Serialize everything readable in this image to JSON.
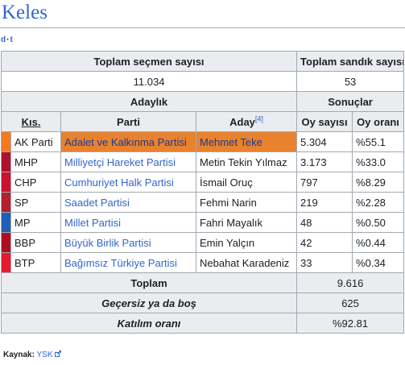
{
  "page": {
    "title": "Keles",
    "navbar": {
      "d": "d",
      "sep": "·",
      "t": "t"
    }
  },
  "summary": {
    "voters_label": "Toplam seçmen sayısı",
    "voters_value": "11.034",
    "boxes_label": "Toplam sandık sayısı",
    "boxes_value": "53"
  },
  "headers": {
    "candidates_group": "Adaylık",
    "results_group": "Sonuçlar",
    "abbr": "Kıs.",
    "party": "Parti",
    "candidate": "Aday",
    "candidate_ref": "[4]",
    "votes": "Oy sayısı",
    "share": "Oy oranı"
  },
  "parties": [
    {
      "abbr": "AK Parti",
      "name": "Adalet ve Kalkınma Partisi",
      "candidate": "Mehmet Teke",
      "candidate_link": true,
      "votes": "5.304",
      "share": "%55.1",
      "color": "#f47920",
      "winner": true
    },
    {
      "abbr": "MHP",
      "name": "Milliyetçi Hareket Partisi",
      "candidate": "Metin Tekin Yılmaz",
      "candidate_link": false,
      "votes": "3.173",
      "share": "%33.0",
      "color": "#b0122a",
      "winner": false
    },
    {
      "abbr": "CHP",
      "name": "Cumhuriyet Halk Partisi",
      "candidate": "İsmail Oruç",
      "candidate_link": false,
      "votes": "797",
      "share": "%8.29",
      "color": "#cc1130",
      "winner": false
    },
    {
      "abbr": "SP",
      "name": "Saadet Partisi",
      "candidate": "Fehmi Narin",
      "candidate_link": false,
      "votes": "219",
      "share": "%2.28",
      "color": "#b51f2e",
      "winner": false
    },
    {
      "abbr": "MP",
      "name": "Millet Partisi",
      "candidate": "Fahri Mayalık",
      "candidate_link": false,
      "votes": "48",
      "share": "%0.50",
      "color": "#1f5fb7",
      "winner": false
    },
    {
      "abbr": "BBP",
      "name": "Büyük Birlik Partisi",
      "candidate": "Emin Yalçın",
      "candidate_link": false,
      "votes": "42",
      "share": "%0.44",
      "color": "#b10d22",
      "winner": false
    },
    {
      "abbr": "BTP",
      "name": "Bağımsız Türkiye Partisi",
      "candidate": "Nebahat Karadeniz",
      "candidate_link": false,
      "votes": "33",
      "share": "%0.34",
      "color": "#e8182f",
      "winner": false
    }
  ],
  "totals": {
    "total_label": "Toplam",
    "total_value": "9.616",
    "invalid_label": "Geçersiz ya da boş",
    "invalid_value": "625",
    "turnout_label": "Katılım oranı",
    "turnout_value": "%92.81"
  },
  "source": {
    "label": "Kaynak:",
    "link_text": "YSK",
    "icon": "external-link-icon"
  }
}
